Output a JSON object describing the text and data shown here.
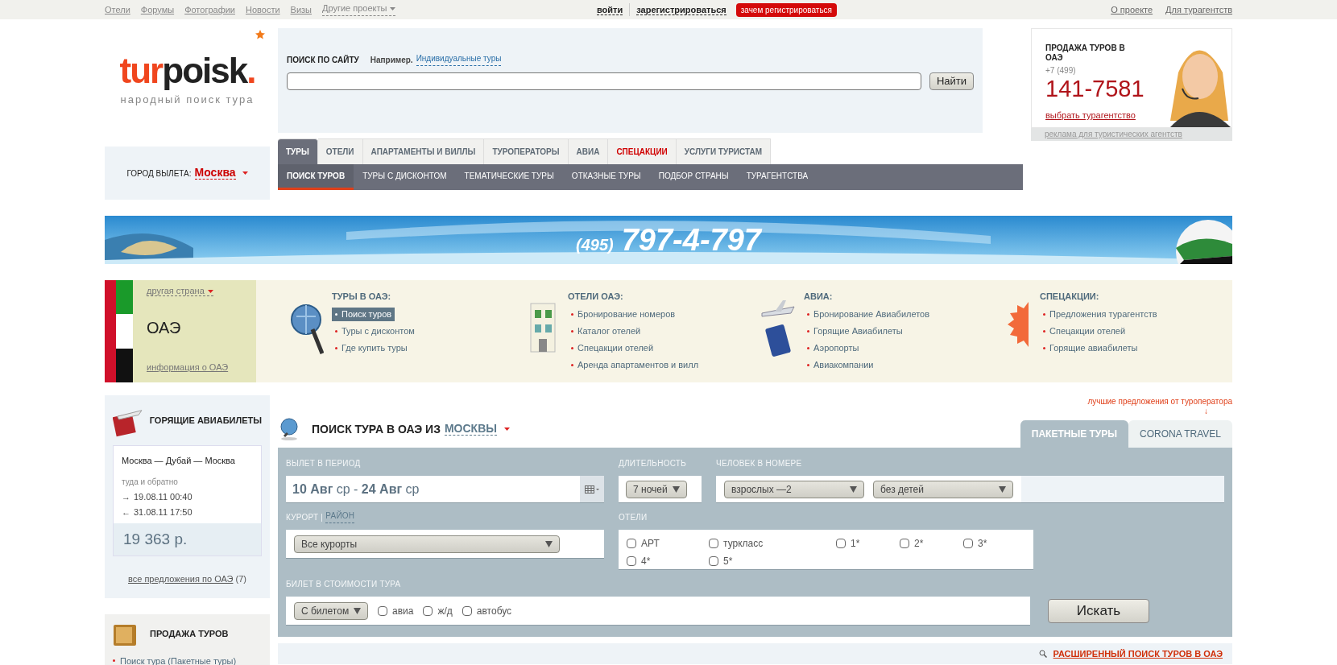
{
  "top_nav": {
    "links": [
      "Отели",
      "Форумы",
      "Фотографии",
      "Новости",
      "Визы"
    ],
    "more": "Другие проекты",
    "login": "войти",
    "register": "зарегистрироваться",
    "register_badge": "зачем регистрироваться",
    "right_links": [
      "О проекте",
      "Для турагентств"
    ]
  },
  "logo": {
    "part_1": "tur",
    "part_2": "poisk",
    "part_3": ".",
    "tagline": "народный поиск тура"
  },
  "site_search": {
    "label": "ПОИСК ПО САЙТУ",
    "example_label": "Например.",
    "example_link": "Индивидуальные туры",
    "button": "Найти"
  },
  "ad": {
    "title": "ПРОДАЖА ТУРОВ В ОАЭ",
    "phone_prefix": "+7 (499)",
    "phone": "141-7581",
    "link": "выбрать турагентство",
    "footer": "реклама для туристических агентств"
  },
  "departure": {
    "label": "ГОРОД ВЫЛЕТА:",
    "city": "Москва"
  },
  "tabs": [
    {
      "label": "ТУРЫ",
      "selected": true,
      "kind": "normal"
    },
    {
      "label": "ОТЕЛИ",
      "selected": false,
      "kind": "normal"
    },
    {
      "label": "АПАРТАМЕНТЫ И ВИЛЛЫ",
      "selected": false,
      "kind": "normal"
    },
    {
      "label": "ТУРОПЕРАТОРЫ",
      "selected": false,
      "kind": "normal"
    },
    {
      "label": "АВИА",
      "selected": false,
      "kind": "normal"
    },
    {
      "label": "СПЕЦАКЦИИ",
      "selected": false,
      "kind": "promo"
    },
    {
      "label": "УСЛУГИ ТУРИСТАМ",
      "selected": false,
      "kind": "normal"
    }
  ],
  "subtabs": [
    {
      "label": "ПОИСК ТУРОВ",
      "selected": true
    },
    {
      "label": "ТУРЫ С ДИСКОНТОМ",
      "selected": false
    },
    {
      "label": "ТЕМАТИЧЕСКИЕ ТУРЫ",
      "selected": false
    },
    {
      "label": "ОТКАЗНЫЕ ТУРЫ",
      "selected": false
    },
    {
      "label": "ПОДБОР СТРАНЫ",
      "selected": false
    },
    {
      "label": "ТУРАГЕНТСТВА",
      "selected": false
    }
  ],
  "banner": {
    "phone_code": "(495)",
    "phone": "797-4-797"
  },
  "country": {
    "other_link": "другая страна",
    "name": "ОАЭ",
    "info_link": "информация о ОАЭ"
  },
  "sections": [
    {
      "kind": "tours",
      "title": "ТУРЫ В ОАЭ:",
      "items": [
        {
          "label": "Поиск туров",
          "selected": true
        },
        {
          "label": "Туры с дисконтом",
          "selected": false
        },
        {
          "label": "Где купить туры",
          "selected": false
        }
      ]
    },
    {
      "kind": "hotels",
      "title": "ОТЕЛИ ОАЭ:",
      "items": [
        {
          "label": "Бронирование номеров",
          "selected": false
        },
        {
          "label": "Каталог отелей",
          "selected": false
        },
        {
          "label": "Спецакции отелей",
          "selected": false
        },
        {
          "label": "Аренда апартаментов и вилл",
          "selected": false
        }
      ]
    },
    {
      "kind": "flights",
      "title": "АВИА:",
      "items": [
        {
          "label": "Бронирование Авиабилетов",
          "selected": false
        },
        {
          "label": "Горящие Авиабилеты",
          "selected": false
        },
        {
          "label": "Аэропорты",
          "selected": false
        },
        {
          "label": "Авиакомпании",
          "selected": false
        }
      ]
    },
    {
      "kind": "promo",
      "title": "СПЕЦАКЦИИ:",
      "items": [
        {
          "label": "Предложения турагентств",
          "selected": false
        },
        {
          "label": "Спецакции отелей",
          "selected": false
        },
        {
          "label": "Горящие авиабилеты",
          "selected": false
        }
      ]
    }
  ],
  "hot_flights": {
    "title": "ГОРЯЩИЕ АВИАБИЛЕТЫ",
    "route": "Москва — Дубай — Москва",
    "trip_type": "туда и обратно",
    "legs": [
      {
        "arrow": "→",
        "datetime": "19.08.11 00:40"
      },
      {
        "arrow": "←",
        "datetime": "31.08.11 17:50"
      }
    ],
    "price": "19 363 р.",
    "all_link": "все предложения по ОАЭ",
    "all_count": "(7)"
  },
  "tour_sales": {
    "title": "ПРОДАЖА ТУРОВ",
    "items": [
      "Поиск тура (Пакетные туры)"
    ]
  },
  "tour_search": {
    "operator_note": "лучшие предложения от туроператора",
    "note_arrow": "↓",
    "title": "ПОИСК ТУРА В ОАЭ ИЗ",
    "city_link": "МОСКВЫ",
    "tabs": [
      {
        "label": "ПАКЕТНЫЕ ТУРЫ",
        "selected": true
      },
      {
        "label": "CORONA TRAVEL",
        "selected": false
      }
    ],
    "period_label": "ВЫЛЕТ В ПЕРИОД",
    "period_value": "**10 Авг** ср - **24 Авг** ср",
    "duration_label": "ДЛИТЕЛЬНОСТЬ",
    "duration": "7 ночей",
    "people_label": "ЧЕЛОВЕК В НОМЕРЕ",
    "adults": "взрослых —2",
    "children": "без детей",
    "resort_label": "КУРОРТ",
    "resort_sep": "|",
    "district_link": "РАЙОН",
    "resort": "Все курорты",
    "hotels_label": "ОТЕЛИ",
    "hotel_classes": [
      {
        "label": "АРТ",
        "checked": false
      },
      {
        "label": "туркласс",
        "checked": false
      },
      {
        "label": "1*",
        "checked": false
      },
      {
        "label": "2*",
        "checked": false
      },
      {
        "label": "3*",
        "checked": false
      },
      {
        "label": "4*",
        "checked": false
      },
      {
        "label": "5*",
        "checked": false
      }
    ],
    "ticket_label": "БИЛЕТ В СТОИМОСТИ ТУРА",
    "ticket": "С билетом",
    "transport": [
      {
        "label": "авиа",
        "checked": false
      },
      {
        "label": "ж/д",
        "checked": false
      },
      {
        "label": "автобус",
        "checked": false
      }
    ],
    "search_button": "Искать",
    "advanced_link": "РАСШИРЕННЫЙ ПОИСК ТУРОВ В ОАЭ"
  }
}
